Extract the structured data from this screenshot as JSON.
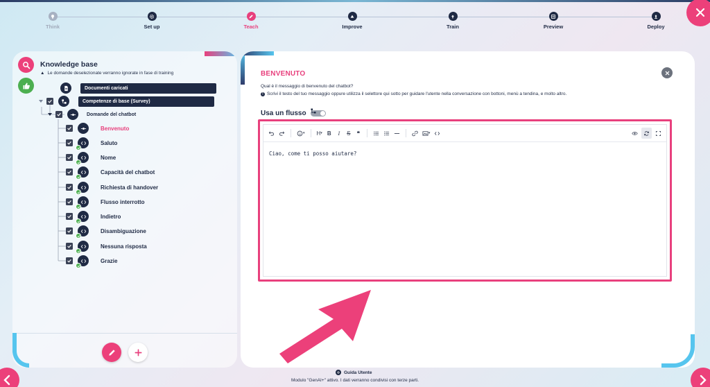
{
  "stepper": {
    "steps": [
      {
        "label": "Think",
        "icon": "lightbulb-icon",
        "state": "disabled"
      },
      {
        "label": "Set up",
        "icon": "gear-icon",
        "state": "done"
      },
      {
        "label": "Teach",
        "icon": "pencil-icon",
        "state": "active"
      },
      {
        "label": "Improve",
        "icon": "improve-icon",
        "state": "done"
      },
      {
        "label": "Train",
        "icon": "upload-icon",
        "state": "done"
      },
      {
        "label": "Preview",
        "icon": "preview-icon",
        "state": "done"
      },
      {
        "label": "Deploy",
        "icon": "deploy-icon",
        "state": "done"
      }
    ]
  },
  "left": {
    "title": "Knowledge base",
    "warning": "Le domande deselezionate verranno ignorate in fase di training",
    "pills": {
      "documents": "Documenti caricati",
      "survey": "Competenze di base (Survey)"
    },
    "group_label": "Domande del chatbot",
    "items": [
      {
        "label": "Benvenuto",
        "selected": true
      },
      {
        "label": "Saluto",
        "selected": false
      },
      {
        "label": "Nome",
        "selected": false
      },
      {
        "label": "Capacità del chatbot",
        "selected": false
      },
      {
        "label": "Richiesta di handover",
        "selected": false
      },
      {
        "label": "Flusso interrotto",
        "selected": false
      },
      {
        "label": "Indietro",
        "selected": false
      },
      {
        "label": "Disambiguazione",
        "selected": false
      },
      {
        "label": "Nessuna risposta",
        "selected": false
      },
      {
        "label": "Grazie",
        "selected": false
      }
    ]
  },
  "right": {
    "title": "BENVENUTO",
    "question": "Qual è il messaggio di benvenuto del chatbot?",
    "info": "Scrivi il testo del tuo messaggio oppure utilizza il selettore qui sotto per guidare l'utente nella conversazione con bottoni, menù a tendina, e molto altro.",
    "flow_label": "Usa un flusso",
    "editor_text": "Ciao, come ti posso aiutare?"
  },
  "footer": {
    "guide": "Guida Utente",
    "note": "Modulo \"GenAI+\" attivo. I dati verranno condivisi con terze parti."
  },
  "colors": {
    "accent": "#e8407d",
    "navy": "#1f2a44",
    "success": "#4caf50",
    "cyan": "#56c5ee"
  }
}
